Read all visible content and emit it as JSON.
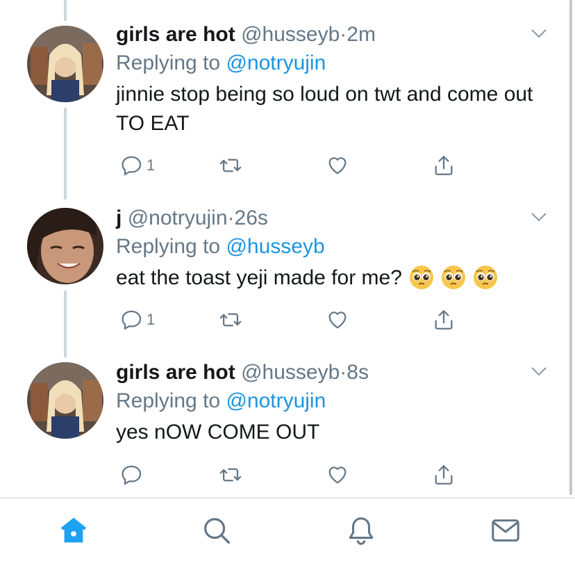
{
  "tweets": [
    {
      "name": "girls are hot",
      "handle": "@husseyb",
      "separator": "·",
      "time": "2m",
      "replying_prefix": "Replying to",
      "replying_to": "@notryujin",
      "text": "jinnie stop being so loud on twt and come out TO EAT",
      "reply_count": "1",
      "avatar": "blonde-girl-avatar"
    },
    {
      "name": "j",
      "handle": "@notryujin",
      "separator": "·",
      "time": "26s",
      "replying_prefix": "Replying to",
      "replying_to": "@husseyb",
      "text": "eat the toast yeji made for me?",
      "emojis": [
        "pleading-face-emoji",
        "pleading-face-emoji",
        "pleading-face-emoji"
      ],
      "reply_count": "1",
      "avatar": "smiling-girl-avatar"
    },
    {
      "name": "girls are hot",
      "handle": "@husseyb",
      "separator": "·",
      "time": "8s",
      "replying_prefix": "Replying to",
      "replying_to": "@notryujin",
      "text": "yes nOW COME OUT",
      "reply_count": "",
      "avatar": "blonde-girl-avatar"
    }
  ],
  "action_icons": [
    "reply-icon",
    "retweet-icon",
    "like-icon",
    "share-icon"
  ],
  "tabbar": {
    "items": [
      "home-icon",
      "search-icon",
      "notifications-icon",
      "messages-icon"
    ],
    "active": "home-icon"
  },
  "colors": {
    "accent": "#1da1f2",
    "mention": "#1b95e0",
    "secondary_text": "#657786",
    "thread_line": "#ccd6dd"
  }
}
